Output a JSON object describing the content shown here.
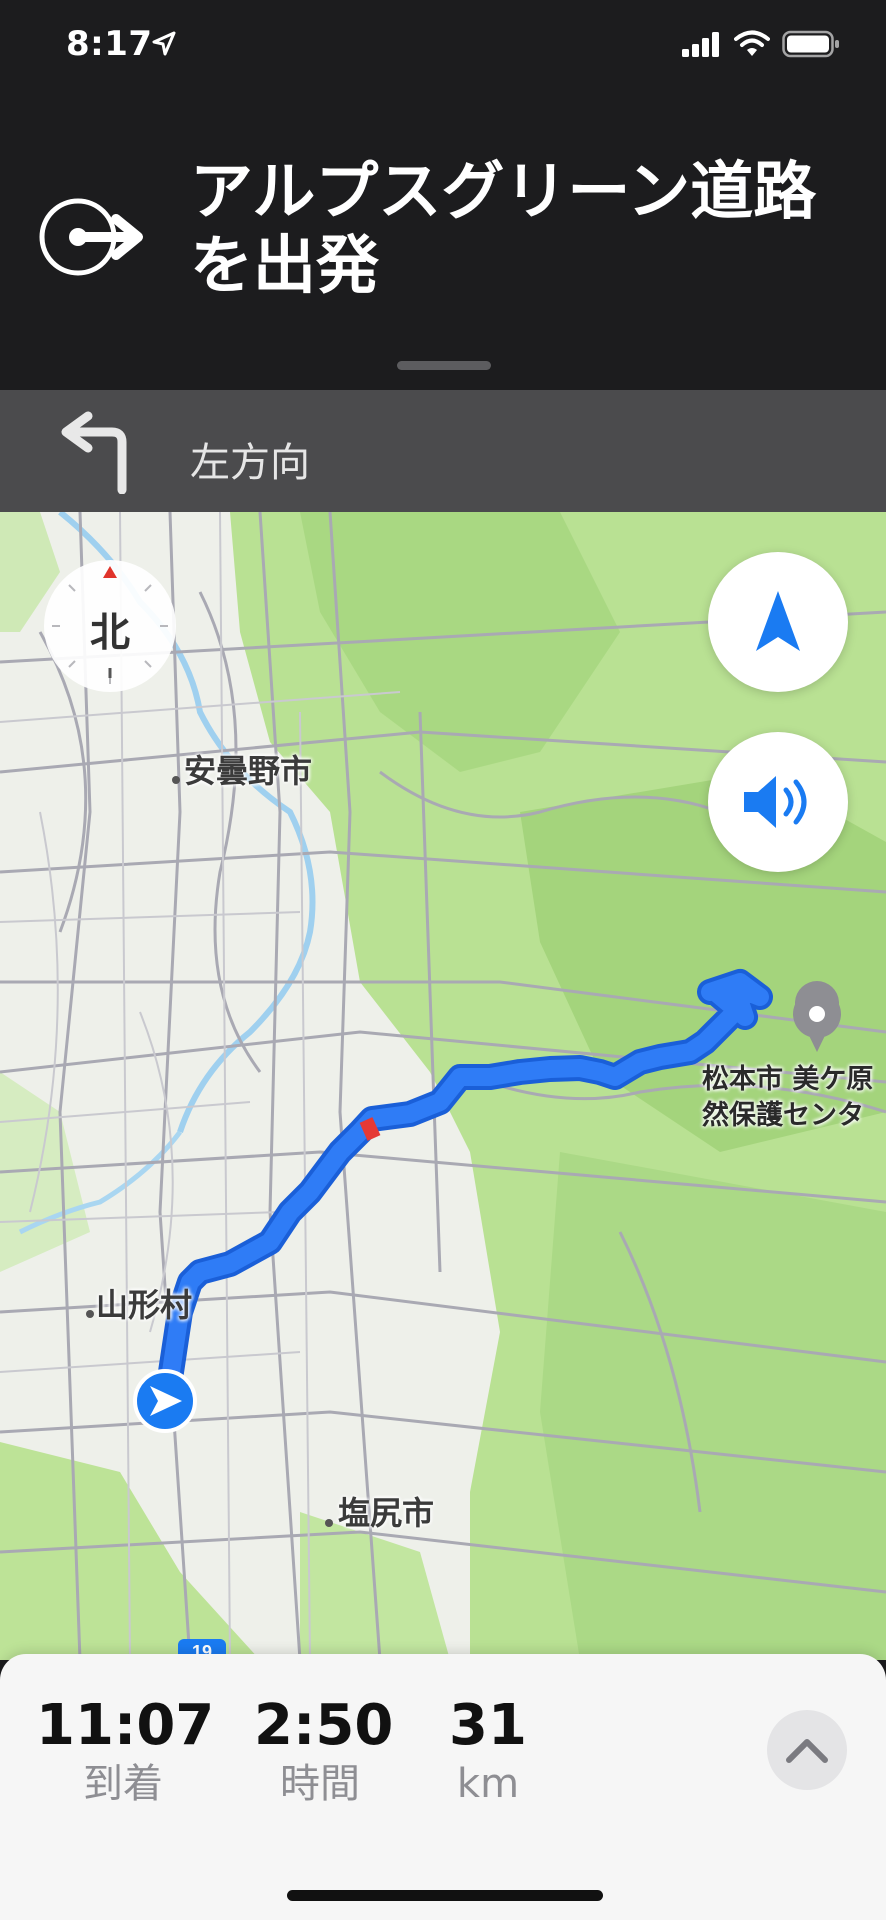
{
  "status_bar": {
    "time": "8:17",
    "icons": [
      "location-arrow-icon",
      "cellular-signal-icon",
      "wifi-icon",
      "battery-icon"
    ]
  },
  "navigation": {
    "instruction": "アルプスグリーン道路を出発",
    "maneuver_icon": "depart-arrow-icon",
    "next_step": {
      "icon": "turn-left-arrow-icon",
      "label": "左方向"
    }
  },
  "map": {
    "compass_label": "北",
    "places": [
      {
        "name": "安曇野市"
      },
      {
        "name": "山形村"
      },
      {
        "name": "塩尻市"
      }
    ],
    "destination": {
      "line1": "松本市 美ケ原",
      "line2": "然保護センタ"
    },
    "road_shield": "19",
    "controls": [
      "tracking-button",
      "audio-button"
    ]
  },
  "trip_summary": {
    "arrival": {
      "value": "11:07",
      "label": "到着"
    },
    "duration": {
      "value": "2:50",
      "label": "時間"
    },
    "distance": {
      "value": "31",
      "label": "km"
    }
  },
  "colors": {
    "route": "#2f7cf6",
    "route_dark": "#1a5fd8",
    "forest": "#b7e08f",
    "banner": "#1c1c1e",
    "next_step_bar": "#4b4b4d",
    "accent_blue": "#1a7bf2"
  }
}
